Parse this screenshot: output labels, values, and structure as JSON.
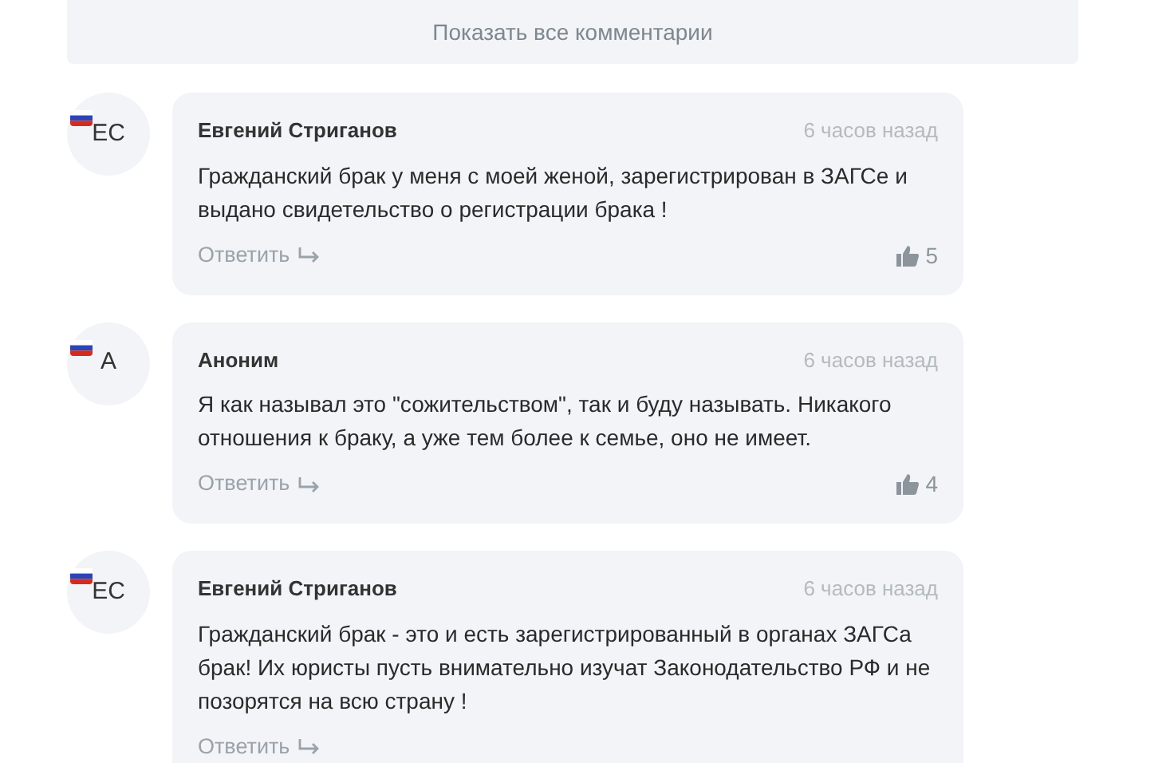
{
  "show_all_button": "Показать все комментарии",
  "comments": [
    {
      "initials": "ЕС",
      "author": "Евгений Стриганов",
      "time": "6 часов назад",
      "text": "Гражданский брак у меня с моей женой, зарегистрирован в ЗАГСе и выдано свидетельство о регистрации брака !",
      "reply": "Ответить",
      "likes": "5"
    },
    {
      "initials": "А",
      "author": "Аноним",
      "time": "6 часов назад",
      "text": "Я как называл это \"сожительством\", так и буду называть. Никакого отношения к браку, а уже тем более к семье, оно не имеет.",
      "reply": "Ответить",
      "likes": "4"
    },
    {
      "initials": "ЕС",
      "author": "Евгений Стриганов",
      "time": "6 часов назад",
      "text": "Гражданский брак - это и есть зарегистрированный в органах ЗАГСа брак! Их юристы пусть  внимательно изучат Законодательство РФ и не позорятся на всю страну !",
      "reply": "Ответить"
    }
  ]
}
